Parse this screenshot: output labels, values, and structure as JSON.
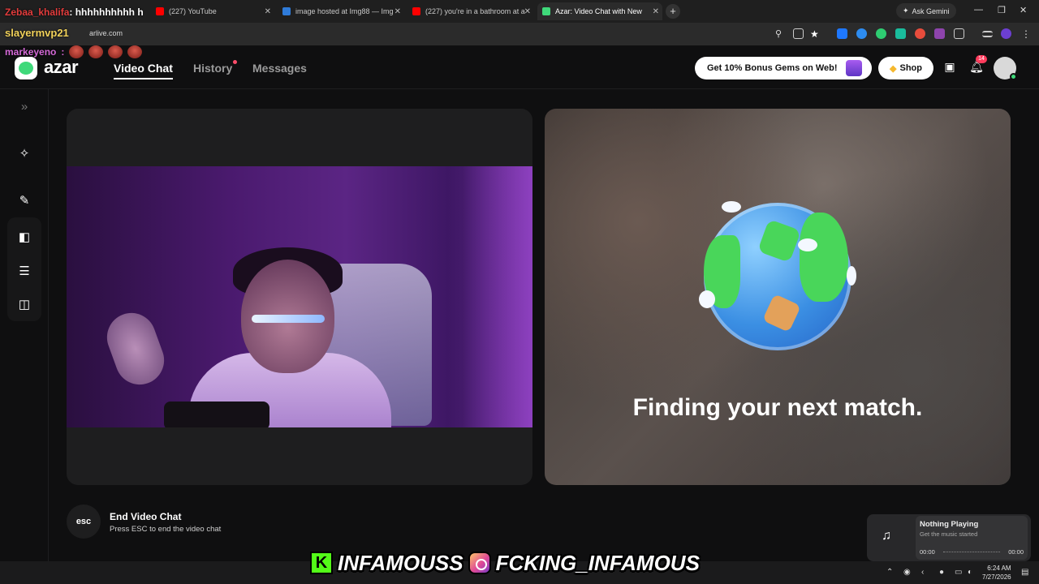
{
  "browser": {
    "tabs": [
      {
        "label": "(227) YouTube",
        "color": "#ff0000"
      },
      {
        "label": "image hosted at Img88 — Img",
        "color": "#2f7bd9"
      },
      {
        "label": "(227) you're in a bathroom at a",
        "color": "#ff0000"
      },
      {
        "label": "Azar: Video Chat with New",
        "color": "#3fd97a"
      }
    ],
    "url": "arlive.com",
    "gemini_label": "Ask Gemini"
  },
  "stream_chat": [
    {
      "user": "Zebaa_khalifa",
      "text": ": hhhhhhhhhh h"
    },
    {
      "user": "slayermvp21",
      "text": ""
    },
    {
      "user": "markeyeno",
      "text": ":"
    }
  ],
  "app": {
    "brand": "azar",
    "nav": {
      "video_chat": "Video Chat",
      "history": "History",
      "messages": "Messages"
    },
    "promo_label": "Get 10% Bonus Gems on Web!",
    "shop_label": "Shop",
    "notification_count": "14"
  },
  "match": {
    "finding_text": "Finding your next match."
  },
  "footer": {
    "esc_key": "esc",
    "end_title": "End Video Chat",
    "end_sub": "Press ESC to end the video chat"
  },
  "media_widget": {
    "title": "Nothing Playing",
    "subtitle": "Get the music started",
    "time_start": "00:00",
    "time_end": "00:00"
  },
  "taskbar": {
    "time": "6:24 AM",
    "date": "7/27/2026"
  },
  "banner": {
    "kick_handle": "INFAMOUSS",
    "insta_handle": "FCKING_INFAMOUS"
  },
  "colors": {
    "accent_green": "#3fd97a",
    "notification_red": "#ff3b5c",
    "kick_green": "#53fc18"
  }
}
